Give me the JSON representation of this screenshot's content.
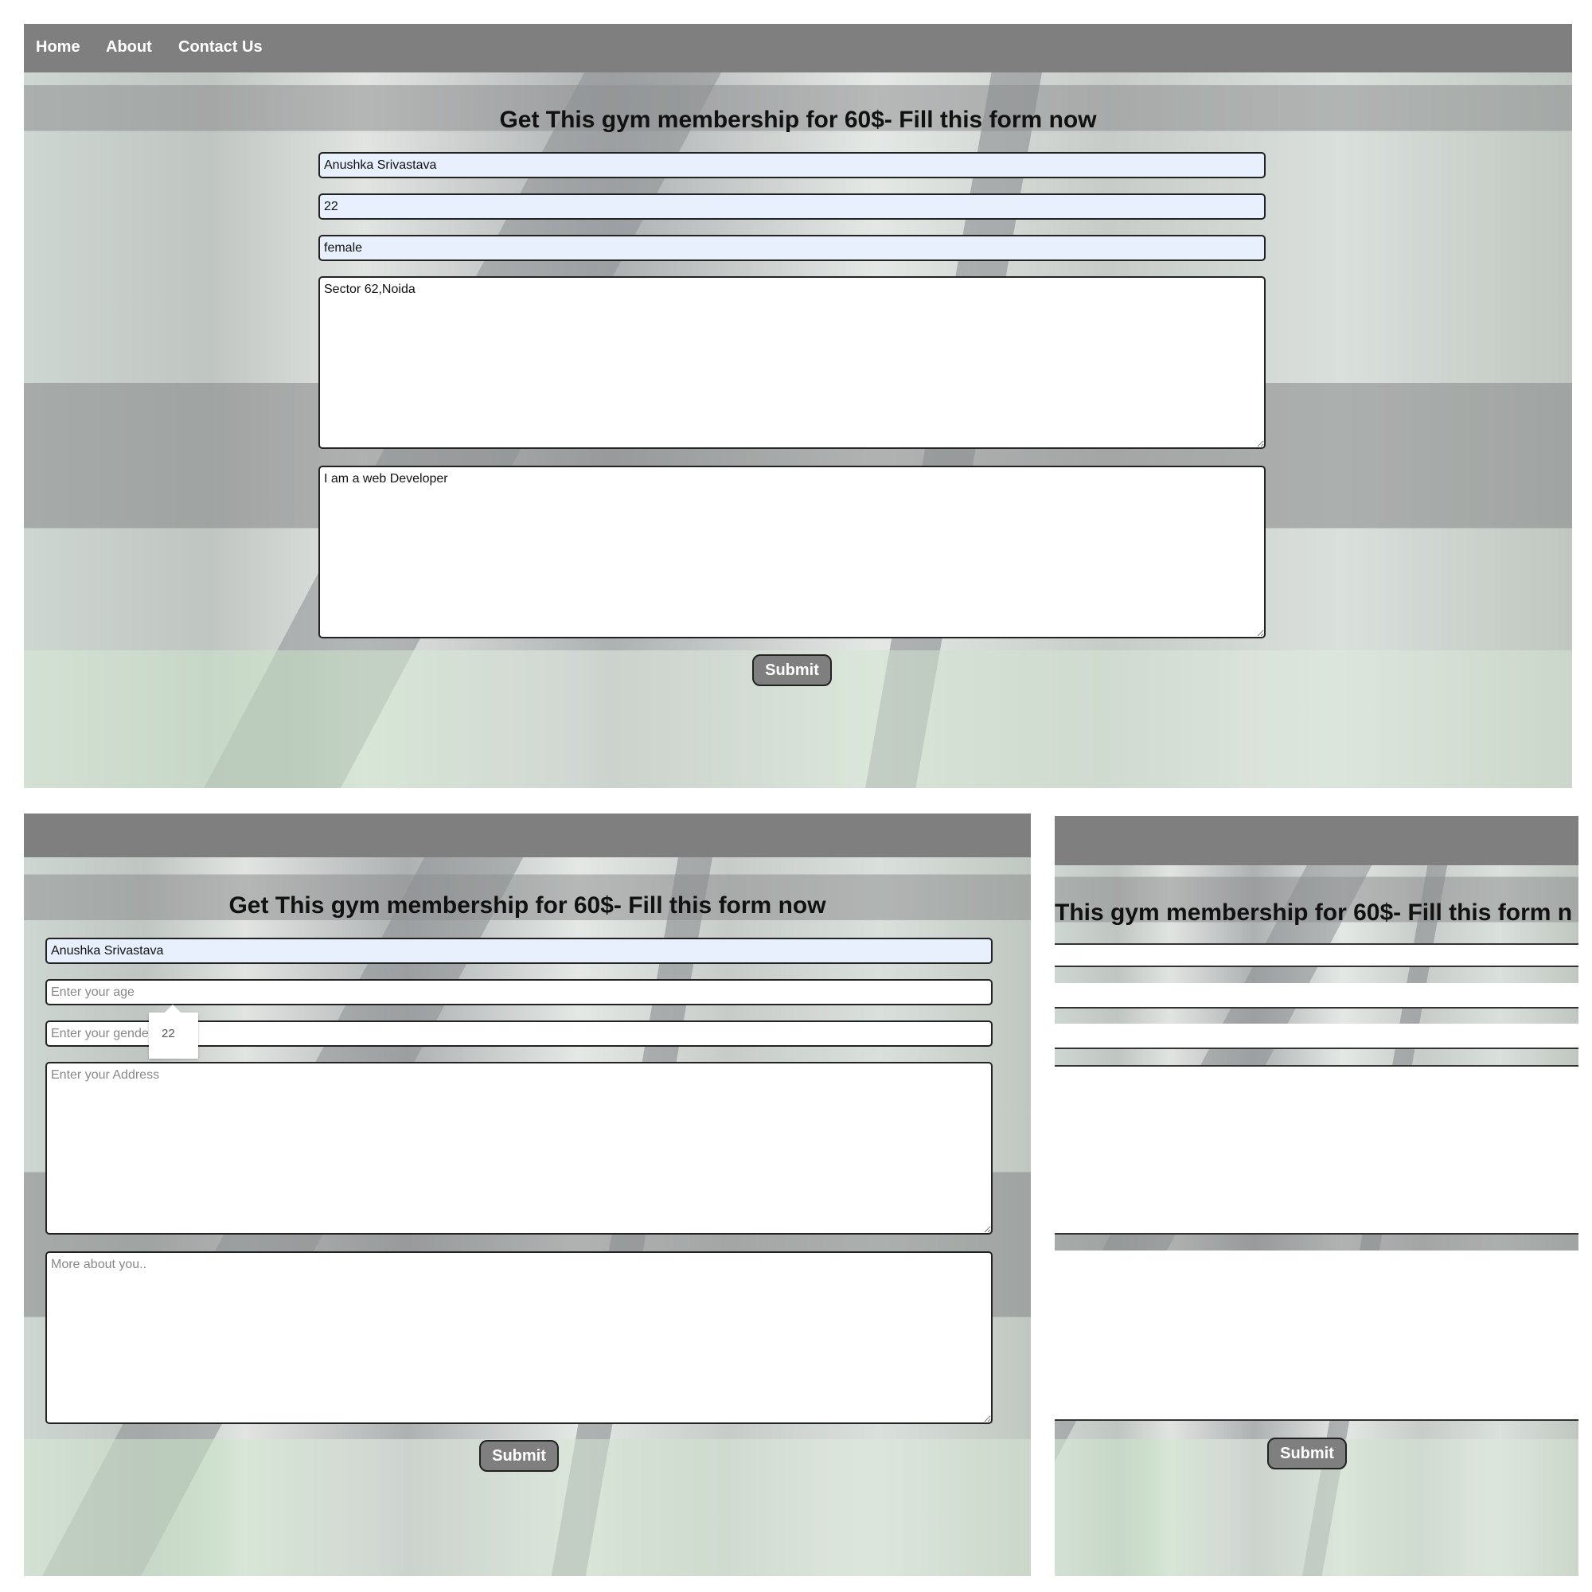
{
  "nav": {
    "home": "Home",
    "about": "About",
    "contact": "Contact Us"
  },
  "form": {
    "title": "Get This gym membership for 60$- Fill this form now",
    "title_cropped": "This gym membership for 60$- Fill this form n",
    "submit_label": "Submit",
    "filled": {
      "name": "Anushka Srivastava",
      "age": "22",
      "gender": "female",
      "address": "Sector 62,Noida",
      "about": "I am a web Developer"
    },
    "placeholders": {
      "age": "Enter your age",
      "gender": "Enter your gender",
      "address": "Enter your Address",
      "about": "More about you.."
    },
    "autocomplete_suggestion": "22"
  }
}
